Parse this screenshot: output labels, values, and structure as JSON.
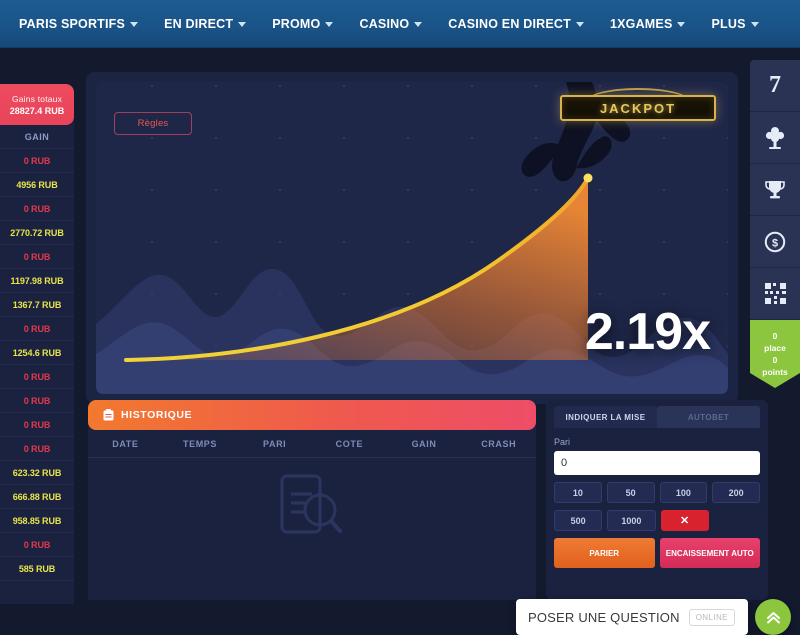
{
  "nav": {
    "items": [
      {
        "label": "PARIS SPORTIFS",
        "caret": true
      },
      {
        "label": "EN DIRECT",
        "caret": true
      },
      {
        "label": "PROMO",
        "caret": true
      },
      {
        "label": "CASINO",
        "caret": true
      },
      {
        "label": "CASINO EN DIRECT",
        "caret": true
      },
      {
        "label": "1XGAMES",
        "caret": true
      },
      {
        "label": "PLUS",
        "caret": true
      }
    ]
  },
  "gains": {
    "title": "Gains totaux",
    "total": "28827.4 RUB",
    "column_header": "GAIN",
    "rows": [
      {
        "value": "0 RUB",
        "kind": "zero"
      },
      {
        "value": "4956 RUB",
        "kind": "win"
      },
      {
        "value": "0 RUB",
        "kind": "zero"
      },
      {
        "value": "2770.72 RUB",
        "kind": "win"
      },
      {
        "value": "0 RUB",
        "kind": "zero"
      },
      {
        "value": "1197.98 RUB",
        "kind": "win"
      },
      {
        "value": "1367.7 RUB",
        "kind": "win"
      },
      {
        "value": "0 RUB",
        "kind": "zero"
      },
      {
        "value": "1254.6 RUB",
        "kind": "win"
      },
      {
        "value": "0 RUB",
        "kind": "zero"
      },
      {
        "value": "0 RUB",
        "kind": "zero"
      },
      {
        "value": "0 RUB",
        "kind": "zero"
      },
      {
        "value": "0 RUB",
        "kind": "zero"
      },
      {
        "value": "623.32 RUB",
        "kind": "win"
      },
      {
        "value": "666.88 RUB",
        "kind": "win"
      },
      {
        "value": "958.85 RUB",
        "kind": "win"
      },
      {
        "value": "0 RUB",
        "kind": "zero"
      },
      {
        "value": "585 RUB",
        "kind": "win"
      }
    ]
  },
  "game": {
    "rules_label": "Règles",
    "jackpot_label": "JACKPOT",
    "multiplier": "2.19x",
    "curve_color": "#f2c230",
    "fill_color": "#ef7b2e"
  },
  "history": {
    "title": "HISTORIQUE",
    "icon": "clipboard-icon",
    "columns": [
      "DATE",
      "TEMPS",
      "PARI",
      "COTE",
      "GAIN",
      "CRASH"
    ],
    "empty_icon": "document-search-icon",
    "rows": []
  },
  "bet": {
    "tab_manual": "INDIQUER LA MISE",
    "tab_auto": "AUTOBET",
    "field_label": "Pari",
    "amount_value": "0",
    "amount_placeholder": "0",
    "chips_row1": [
      "10",
      "50",
      "100",
      "200"
    ],
    "chips_row2": [
      "500",
      "1000"
    ],
    "clear_label": "✕",
    "action_left": "PARIER",
    "action_right": "ENCAISSEMENT AUTO"
  },
  "rail": {
    "items": [
      {
        "icon": "lucky-seven-icon",
        "label": "7"
      },
      {
        "icon": "tree-bonus-icon",
        "label": ""
      },
      {
        "icon": "trophy-icon",
        "label": ""
      },
      {
        "icon": "dollar-coin-icon",
        "label": ""
      },
      {
        "icon": "qr-grid-icon",
        "label": ""
      }
    ],
    "badge": {
      "place": "0",
      "place_label": "place",
      "points": "0",
      "points_label": "points"
    }
  },
  "chat": {
    "label": "POSER UNE QUESTION",
    "status": "ONLINE",
    "scroll_top_icon": "chevron-double-up-icon"
  },
  "colors": {
    "nav_blue": "#1a5488",
    "accent_red": "#ef4b5f",
    "accent_orange": "#ef7b2e",
    "gold": "#d8b24a",
    "green": "#8cc63f",
    "panel": "#1b2240",
    "stage": "#131a2e"
  }
}
